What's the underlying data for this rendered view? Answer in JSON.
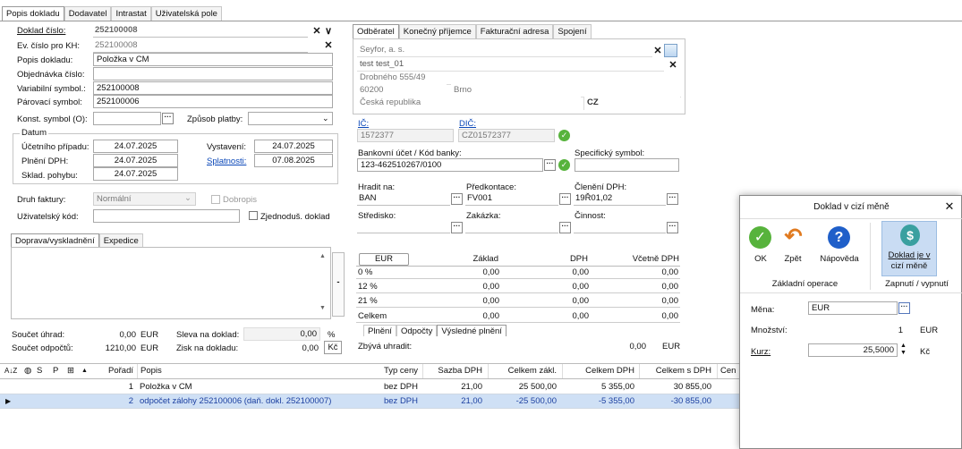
{
  "main_tabs": [
    "Popis dokladu",
    "Dodavatel",
    "Intrastat",
    "Uživatelská pole"
  ],
  "doc": {
    "cislo_label": "Doklad číslo:",
    "cislo_value": "252100008",
    "ev_label": "Ev. číslo pro KH:",
    "ev_value": "252100008",
    "popis_label": "Popis dokladu:",
    "popis_value": "Položka v CM",
    "objednavka_label": "Objednávka číslo:",
    "objednavka_value": "",
    "vs_label": "Variabilní symbol.:",
    "vs_value": "252100008",
    "parovaci_label": "Párovací symbol:",
    "parovaci_value": "252100006",
    "konst_label": "Konst. symbol (O):",
    "konst_value": "",
    "zpusob_label": "Způsob platby:",
    "zpusob_value": ""
  },
  "datum": {
    "title": "Datum",
    "ucetni_label": "Účetního případu:",
    "ucetni_value": "24.07.2025",
    "plneni_label": "Plnění DPH:",
    "plneni_value": "24.07.2025",
    "sklad_label": "Sklad. pohybu:",
    "sklad_value": "24.07.2025",
    "vystaveni_label": "Vystavení:",
    "vystaveni_value": "24.07.2025",
    "splatnost_label": "Splatnosti:",
    "splatnost_value": "07.08.2025"
  },
  "druh": {
    "druh_label": "Druh faktury:",
    "druh_value": "Normální",
    "dobropis_label": "Dobropis",
    "uziv_label": "Uživatelský kód:",
    "uziv_value": "",
    "zjednodus_label": "Zjednoduš. doklad"
  },
  "doprava_tabs": [
    "Doprava/vyskladnění",
    "Expedice"
  ],
  "totals_left": {
    "soucet_uhrad_label": "Součet úhrad:",
    "soucet_uhrad_value": "0,00",
    "soucet_uhrad_cur": "EUR",
    "soucet_odpoctu_label": "Součet odpočtů:",
    "soucet_odpoctu_value": "1210,00",
    "soucet_odpoctu_cur": "EUR",
    "sleva_label": "Sleva na doklad:",
    "sleva_value": "0,00",
    "sleva_unit": "%",
    "zisk_label": "Zisk na dokladu:",
    "zisk_value": "0,00",
    "zisk_unit": "Kč"
  },
  "partner_tabs": [
    "Odběratel",
    "Konečný příjemce",
    "Fakturační adresa",
    "Spojení"
  ],
  "partner": {
    "name": "Seyfor, a. s.",
    "contact": "test test_01",
    "street": "Drobného 555/49",
    "zip": "60200",
    "city": "Brno",
    "country": "Česká republika",
    "country_code": "CZ",
    "ic_label": "IČ:",
    "ic_value": "1572377",
    "dic_label": "DIČ:",
    "dic_value": "CZ01572377",
    "bank_label": "Bankovní účet / Kód banky:",
    "bank_value": "123-462510267/0100",
    "spec_label": "Specifický symbol:",
    "spec_value": "",
    "hradit_label": "Hradit na:",
    "hradit_value": "BAN",
    "predkont_label": "Předkontace:",
    "predkont_value": "FV001",
    "cleneni_label": "Členění DPH:",
    "cleneni_value": "19Ř01,02",
    "stredisko_label": "Středisko:",
    "stredisko_value": "",
    "zakazka_label": "Zakázka:",
    "zakazka_value": "",
    "cinnost_label": "Činnost:",
    "cinnost_value": ""
  },
  "vat": {
    "currency_btn": "EUR",
    "headers": [
      "Základ",
      "DPH",
      "Včetně DPH"
    ],
    "rows": [
      {
        "label": "0 %",
        "zaklad": "0,00",
        "dph": "0,00",
        "vcetne": "0,00"
      },
      {
        "label": "12 %",
        "zaklad": "0,00",
        "dph": "0,00",
        "vcetne": "0,00"
      },
      {
        "label": "21 %",
        "zaklad": "0,00",
        "dph": "0,00",
        "vcetne": "0,00"
      },
      {
        "label": "Celkem",
        "zaklad": "0,00",
        "dph": "0,00",
        "vcetne": "0,00"
      }
    ],
    "subtabs": [
      "Plnění",
      "Odpočty",
      "Výsledné plnění"
    ],
    "zbyva_label": "Zbývá uhradit:",
    "zbyva_value": "0,00",
    "zbyva_cur": "EUR"
  },
  "grid": {
    "headers": {
      "s": "S",
      "p": "P",
      "poradi": "Pořadí",
      "popis": "Popis",
      "typ": "Typ ceny",
      "sazba": "Sazba DPH",
      "zakl": "Celkem zákl.",
      "dph": "Celkem DPH",
      "sdph": "Celkem s DPH",
      "cen": "Cen"
    },
    "rows": [
      {
        "poradi": "1",
        "popis": "Položka v CM",
        "typ": "bez DPH",
        "sazba": "21,00",
        "zakl": "25 500,00",
        "dph": "5 355,00",
        "sdph": "30 855,00"
      },
      {
        "poradi": "2",
        "popis": "odpočet zálohy 252100006 (daň. dokl. 252100007)",
        "typ": "bez DPH",
        "sazba": "21,00",
        "zakl": "-25 500,00",
        "dph": "-5 355,00",
        "sdph": "-30 855,00"
      }
    ]
  },
  "dialog": {
    "title": "Doklad v cizí měně",
    "ok": "OK",
    "zpet": "Zpět",
    "napoveda": "Nápověda",
    "doklad_line1": "Doklad je v",
    "doklad_line2": "cizí měně",
    "group1": "Základní operace",
    "group2": "Zapnutí / vypnutí",
    "mena_label": "Měna:",
    "mena_value": "EUR",
    "mnozstvi_label": "Množství:",
    "mnozstvi_value": "1",
    "mnozstvi_cur": "EUR",
    "kurz_label": "Kurz:",
    "kurz_value": "25,5000",
    "kurz_cur": "Kč"
  },
  "colors": {
    "link": "#0a47b8",
    "selected_row": "#cfe0f5",
    "ok_green": "#57b33c",
    "help_blue": "#1f5fc9",
    "back_orange": "#e07a1f"
  }
}
